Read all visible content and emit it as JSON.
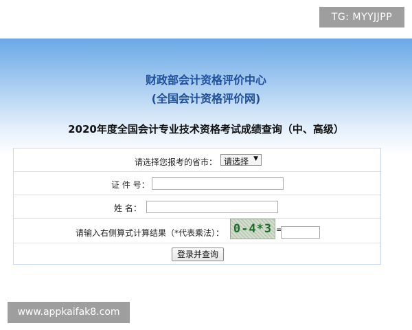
{
  "overlay": {
    "tg_label": "TG: MYYJJPP",
    "watermark": "www.appkaifak8.com"
  },
  "header": {
    "org_name": "财政部会计资格评价中心",
    "org_subtitle": "(全国会计资格评价网)",
    "page_title": "2020年度全国会计专业技术资格考试成绩查询（中、高级）"
  },
  "form": {
    "province_label": "请选择您报考的省市：",
    "province_selected": "请选择",
    "id_label": "证 件 号：",
    "id_value": "",
    "name_label": "姓  名：",
    "name_value": "",
    "captcha_label": "请输入右侧算式计算结果（*代表乘法）：",
    "captcha_text": "0-4*3",
    "equals_sign": "=",
    "captcha_value": "",
    "submit_label": "登录并查询"
  },
  "colors": {
    "header_gradient_top": "#6aa9e6",
    "org_text": "#1f4e9a",
    "table_border": "#c9d9ea",
    "captcha_text": "#1d6b2a"
  }
}
